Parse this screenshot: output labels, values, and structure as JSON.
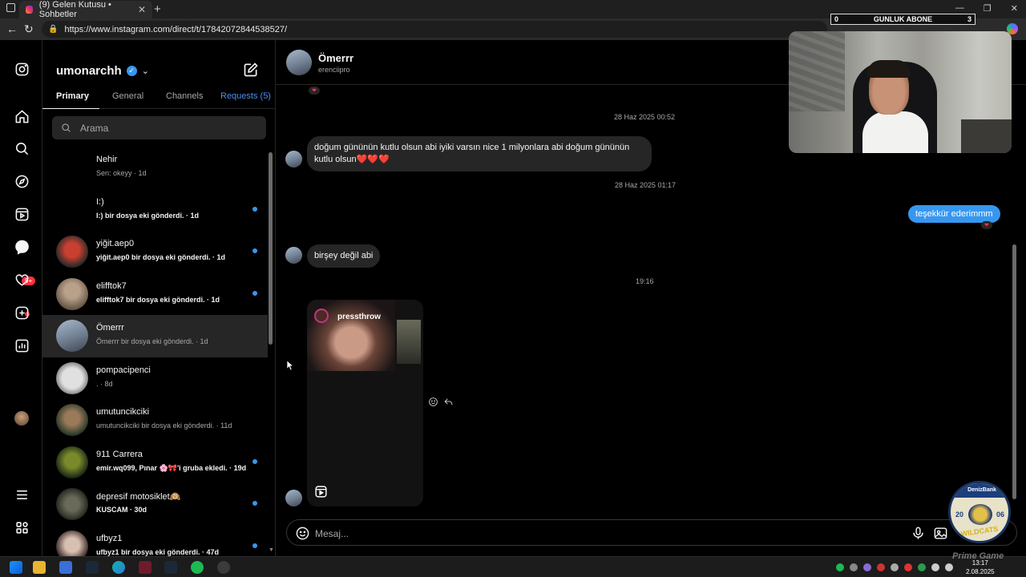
{
  "browser": {
    "tab_title": "(9) Gelen Kutusu • Sohbetler",
    "tab_close": "✕",
    "new_tab": "+",
    "url": "https://www.instagram.com/direct/t/17842072844538527/"
  },
  "overlay": {
    "abone_left": "0",
    "abone_label": "GUNLUK ABONE",
    "abone_right": "3",
    "logo_top": "DenizBank",
    "logo_year_left": "20",
    "logo_year_right": "06",
    "logo_name": "WILDCATS",
    "watermark": "Prime Game"
  },
  "rail": {
    "notif_badge": "9+"
  },
  "inbox": {
    "username": "umonarchh",
    "tabs": {
      "primary": "Primary",
      "general": "General",
      "channels": "Channels",
      "requests": "Requests (5)"
    },
    "search_placeholder": "Arama",
    "conversations": [
      {
        "name": "Nehir",
        "preview": "Sen: okeyy · 1d",
        "unread": false
      },
      {
        "name": "I:)",
        "preview": "I:) bir dosya eki gönderdi. · 1d",
        "unread": true
      },
      {
        "name": "yiğit.aep0",
        "preview": "yiğit.aep0 bir dosya eki gönderdi. · 1d",
        "unread": true
      },
      {
        "name": "elifftok7",
        "preview": "elifftok7 bir dosya eki gönderdi. · 1d",
        "unread": true
      },
      {
        "name": "Ömerrr",
        "preview": "Ömerrr bir dosya eki gönderdi. · 1d",
        "unread": false
      },
      {
        "name": "pompacipenci",
        "preview": ". · 8d",
        "unread": false
      },
      {
        "name": "umutuncikciki",
        "preview": "umutuncikciki bir dosya eki gönderdi. · 11d",
        "unread": false
      },
      {
        "name": "911 Carrera",
        "preview": "emir.wq099, Pınar 🌸🎀'i gruba ekledi. · 19d",
        "unread": true
      },
      {
        "name": "depresif motosiklet🙉",
        "preview": "KUSCAM · 30d",
        "unread": true
      },
      {
        "name": "ufbyz1",
        "preview": "ufbyz1 bir dosya eki gönderdi. · 47d",
        "unread": true
      }
    ]
  },
  "chat": {
    "name": "Ömerrr",
    "handle": "erenciipro",
    "ts1": "28 Haz 2025 00:52",
    "msg1": "doğum gününün kutlu olsun abi iyiki varsın nice 1 milyonlara abi doğum gününün kutlu olsun❤️❤️❤️",
    "ts2": "28 Haz 2025 01:17",
    "msg2": "teşekkür ederimmm",
    "msg3": "birşey değil abi",
    "ts3": "19:16",
    "reel_user": "pressthrow",
    "reaction": "❤",
    "composer_placeholder": "Mesaj..."
  },
  "taskbar": {
    "time": "13:17",
    "date": "2.08.2025"
  }
}
